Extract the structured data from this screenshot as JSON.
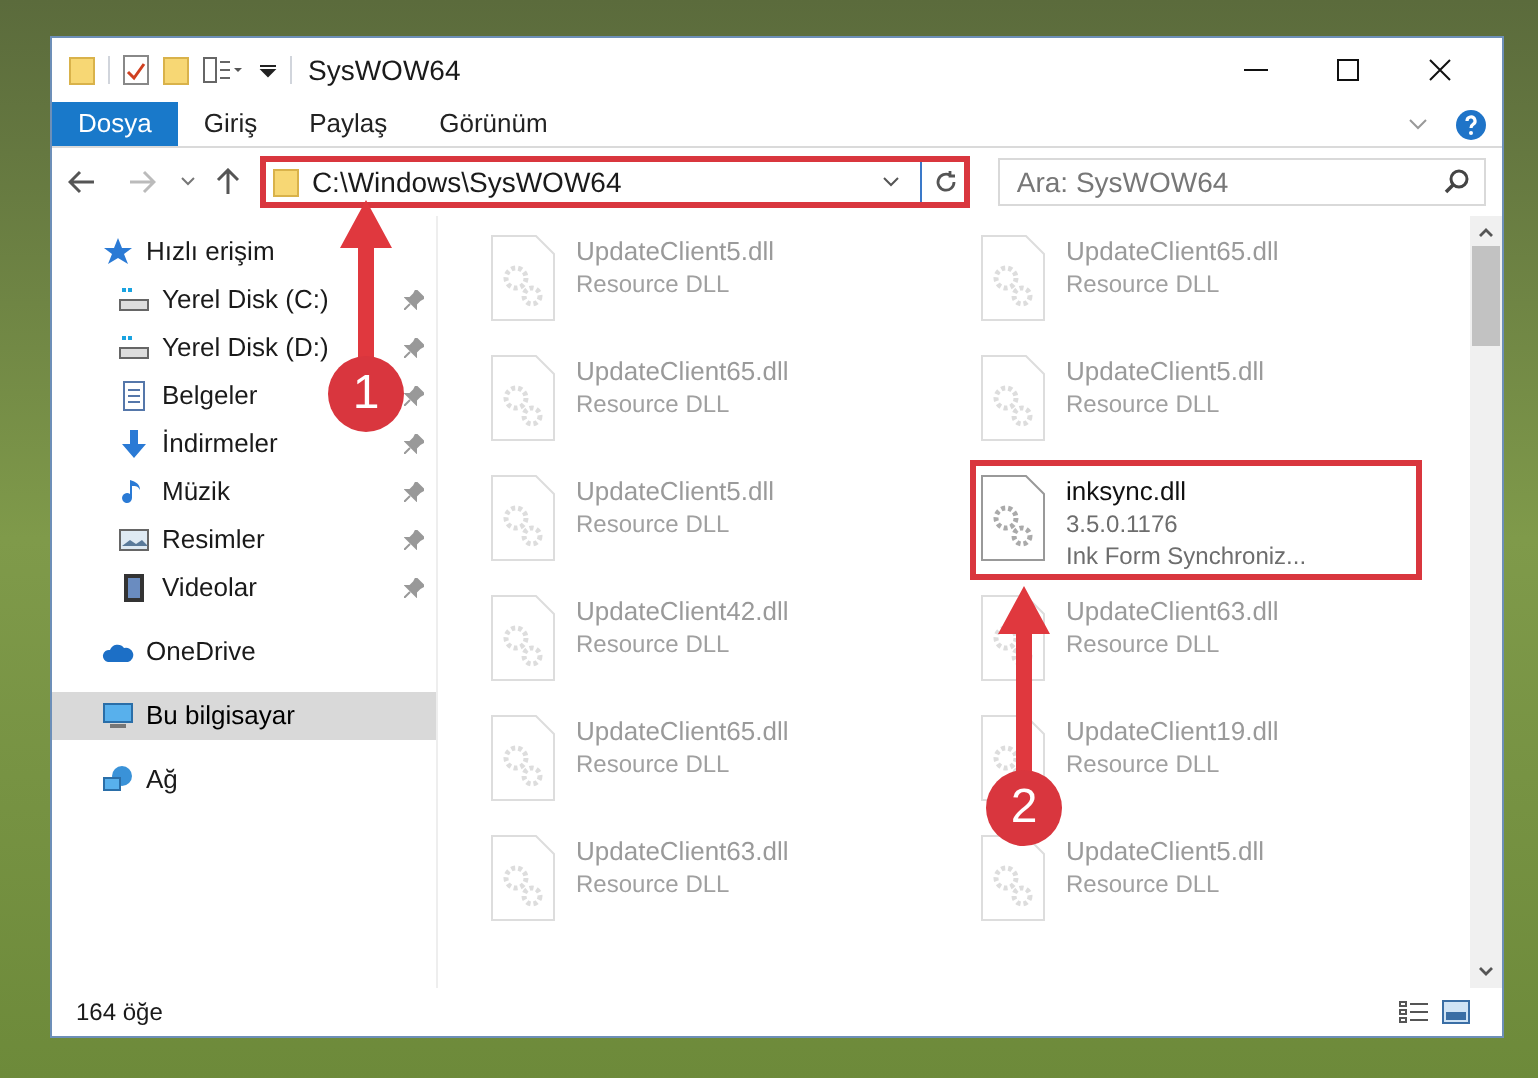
{
  "window": {
    "title": "SysWOW64"
  },
  "ribbon_tabs": [
    {
      "label": "Dosya",
      "selected": true
    },
    {
      "label": "Giriş",
      "selected": false
    },
    {
      "label": "Paylaş",
      "selected": false
    },
    {
      "label": "Görünüm",
      "selected": false
    }
  ],
  "address_bar": {
    "path": "C:\\Windows\\SysWOW64",
    "highlighted": true
  },
  "search": {
    "placeholder": "Ara: SysWOW64"
  },
  "sidebar": {
    "items": [
      {
        "label": "Hızlı erişim",
        "kind": "star",
        "selected": false,
        "children": [
          {
            "label": "Yerel Disk (C:)",
            "kind": "drive",
            "pinned": true,
            "selected": false
          },
          {
            "label": "Yerel Disk (D:)",
            "kind": "drive",
            "pinned": true,
            "selected": false
          },
          {
            "label": "Belgeler",
            "kind": "document",
            "pinned": true,
            "selected": false
          },
          {
            "label": "İndirmeler",
            "kind": "download",
            "pinned": true,
            "selected": false
          },
          {
            "label": "Müzik",
            "kind": "music",
            "pinned": true,
            "selected": false
          },
          {
            "label": "Resimler",
            "kind": "picture",
            "pinned": true,
            "selected": false
          },
          {
            "label": "Videolar",
            "kind": "video",
            "pinned": true,
            "selected": false
          }
        ]
      },
      {
        "label": "OneDrive",
        "kind": "cloud",
        "selected": false
      },
      {
        "label": "Bu bilgisayar",
        "kind": "computer",
        "selected": true
      },
      {
        "label": "Ağ",
        "kind": "network",
        "selected": false
      }
    ]
  },
  "files": [
    {
      "name": "UpdateClient5.dll",
      "lines": [
        "Resource DLL"
      ],
      "blurred": true,
      "highlighted": false
    },
    {
      "name": "UpdateClient65.dll",
      "lines": [
        "Resource DLL"
      ],
      "blurred": true,
      "highlighted": false
    },
    {
      "name": "UpdateClient65.dll",
      "lines": [
        "Resource DLL"
      ],
      "blurred": true,
      "highlighted": false
    },
    {
      "name": "UpdateClient5.dll",
      "lines": [
        "Resource DLL"
      ],
      "blurred": true,
      "highlighted": false
    },
    {
      "name": "UpdateClient5.dll",
      "lines": [
        "Resource DLL"
      ],
      "blurred": true,
      "highlighted": false
    },
    {
      "name": "inksync.dll",
      "lines": [
        "3.5.0.1176",
        "Ink Form Synchroniz..."
      ],
      "blurred": false,
      "highlighted": true
    },
    {
      "name": "UpdateClient42.dll",
      "lines": [
        "Resource DLL"
      ],
      "blurred": true,
      "highlighted": false
    },
    {
      "name": "UpdateClient63.dll",
      "lines": [
        "Resource DLL"
      ],
      "blurred": true,
      "highlighted": false
    },
    {
      "name": "UpdateClient65.dll",
      "lines": [
        "Resource DLL"
      ],
      "blurred": true,
      "highlighted": false
    },
    {
      "name": "UpdateClient19.dll",
      "lines": [
        "Resource DLL"
      ],
      "blurred": true,
      "highlighted": false
    },
    {
      "name": "UpdateClient63.dll",
      "lines": [
        "Resource DLL"
      ],
      "blurred": true,
      "highlighted": false
    },
    {
      "name": "UpdateClient5.dll",
      "lines": [
        "Resource DLL"
      ],
      "blurred": true,
      "highlighted": false
    }
  ],
  "callouts": [
    {
      "number": "1"
    },
    {
      "number": "2"
    }
  ],
  "status_bar": {
    "count": "164 öğe"
  }
}
